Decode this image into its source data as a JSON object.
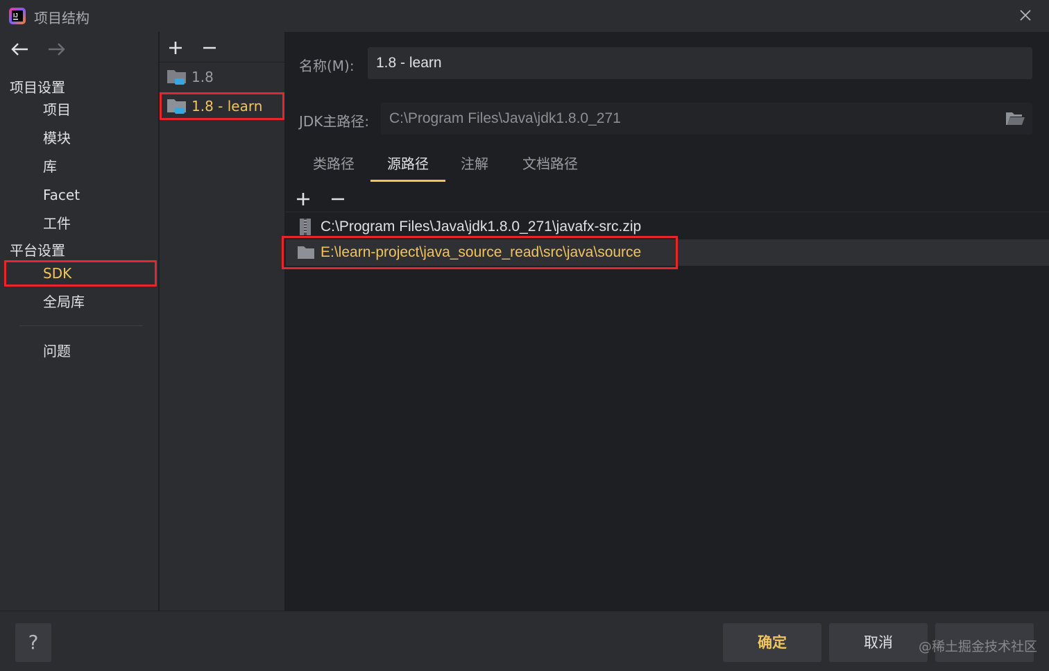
{
  "window": {
    "title": "项目结构",
    "close_icon": "close-icon"
  },
  "nav": {
    "back_icon": "arrow-left-icon",
    "forward_icon": "arrow-right-icon",
    "sections": [
      {
        "label": "项目设置",
        "items": [
          "项目",
          "模块",
          "库",
          "Facet",
          "工件"
        ]
      },
      {
        "label": "平台设置",
        "items": [
          "SDK",
          "全局库"
        ]
      }
    ],
    "problems": "问题",
    "selected": "SDK"
  },
  "sdk_list": {
    "add_icon": "plus-icon",
    "remove_icon": "minus-icon",
    "items": [
      "1.8",
      "1.8 - learn"
    ],
    "selected": "1.8 - learn"
  },
  "detail": {
    "name_label": "名称(M):",
    "name_value": "1.8 - learn",
    "jdk_label": "JDK主路径:",
    "jdk_value": "C:\\Program Files\\Java\\jdk1.8.0_271",
    "tabs": [
      "类路径",
      "源路径",
      "注解",
      "文档路径"
    ],
    "active_tab": "源路径",
    "paths": [
      "C:\\Program Files\\Java\\jdk1.8.0_271\\javafx-src.zip",
      "E:\\learn-project\\java_source_read\\src\\java\\source"
    ],
    "selected_path": "E:\\learn-project\\java_source_read\\src\\java\\source"
  },
  "footer": {
    "help": "?",
    "ok": "确定",
    "cancel": "取消",
    "watermark": "@稀土掘金技术社区"
  },
  "colors": {
    "accent": "#f2c55c",
    "highlight_box": "#e5272b",
    "background": "#1e1f22",
    "panel": "#2b2d30"
  }
}
